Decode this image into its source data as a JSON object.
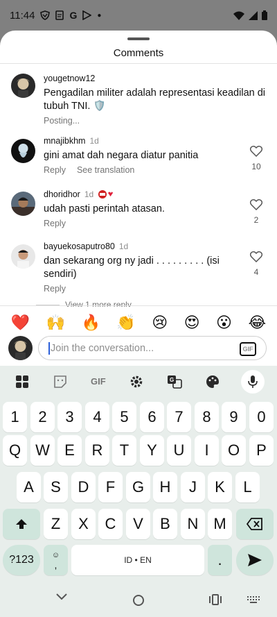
{
  "status": {
    "time": "11:44"
  },
  "sheet": {
    "title": "Comments"
  },
  "comments": [
    {
      "user": "yougetnow12",
      "time": "",
      "text": "Pengadilan militer adalah representasi keadilan di tubuh TNI. 🛡️",
      "status": "Posting...",
      "reply": "",
      "translate": "",
      "likes": ""
    },
    {
      "user": "mnajibkhm",
      "time": "1d",
      "text": "gini amat dah negara diatur panitia",
      "reply": "Reply",
      "translate": "See translation",
      "likes": "10"
    },
    {
      "user": "dhoridhor",
      "time": "1d",
      "text": "udah pasti perintah atasan.",
      "reply": "Reply",
      "translate": "",
      "likes": "2"
    },
    {
      "user": "bayuekosaputro80",
      "time": "1d",
      "text": "dan sekarang org ny jadi . . . . . . . . . (isi sendiri)",
      "reply": "Reply",
      "translate": "",
      "likes": "4"
    }
  ],
  "more_replies": "View 1 more reply",
  "reactions": [
    "❤️",
    "🙌",
    "🔥",
    "👏",
    "😢",
    "😍",
    "😮",
    "😂"
  ],
  "compose": {
    "placeholder": "Join the conversation...",
    "gif_label": "GIF"
  },
  "keyboard": {
    "toolbar": {
      "gif": "GIF"
    },
    "row_numbers": [
      "1",
      "2",
      "3",
      "4",
      "5",
      "6",
      "7",
      "8",
      "9",
      "0"
    ],
    "row_1": [
      "Q",
      "W",
      "E",
      "R",
      "T",
      "Y",
      "U",
      "I",
      "O",
      "P"
    ],
    "row_2": [
      "A",
      "S",
      "D",
      "F",
      "G",
      "H",
      "J",
      "K",
      "L"
    ],
    "row_3": [
      "Z",
      "X",
      "C",
      "V",
      "B",
      "N",
      "M"
    ],
    "symbols_label": "?123",
    "emoji_comma": ",",
    "space_label": "ID • EN",
    "period_label": "."
  },
  "colors": {
    "accent_key": "#cfe5dc",
    "keyboard_bg": "#e8eeeb",
    "cursor": "#2b5fd9"
  }
}
